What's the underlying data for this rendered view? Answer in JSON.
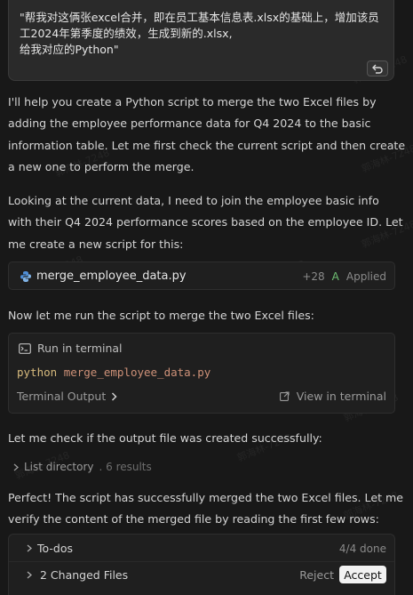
{
  "user_message": {
    "line1": "\"帮我对这俩张excel合并，即在员工基本信息表.xlsx的基础上，增加该员",
    "line2": "工2024年第季度的绩效，生成到新的.xlsx,",
    "line3": "给我对应的Python\""
  },
  "paragraphs": {
    "p1": "I'll help you create a Python script to merge the two Excel files by adding the employee performance data for Q4 2024 to the basic information table. Let me first check the current script and then create a new one to perform the merge.",
    "p2": "Looking at the current data, I need to join the employee basic info with their Q4 2024 performance scores based on the employee ID. Let me create a new script for this:",
    "p3": "Now let me run the script to merge the two Excel files:",
    "p4": "Let me check if the output file was created successfully:",
    "p5": "Perfect! The script has successfully merged the two Excel files. Let me verify the content of the merged file by reading the first few rows:"
  },
  "file_card": {
    "icon": "python-icon",
    "filename": "merge_employee_data.py",
    "diff": "+28",
    "badge": "A",
    "status": "Applied"
  },
  "terminal": {
    "title": "Run in terminal",
    "command_keyword": "python",
    "command_arg": "merge_employee_data.py",
    "output_label": "Terminal Output",
    "view_label": "View in terminal"
  },
  "list_directory": {
    "label": "List directory",
    "results": ". 6 results"
  },
  "bottom_panel": {
    "todos_label": "To-dos",
    "todos_count": "4/4 done",
    "changed_files_label": "2 Changed Files",
    "reject_label": "Reject",
    "accept_label": "Accept"
  },
  "watermark": "郭海林-7248",
  "colors": {
    "background": "#181818",
    "accent_green": "#6fbf73",
    "code_keyword": "#d7ba7d",
    "code_string": "#ce9178"
  }
}
